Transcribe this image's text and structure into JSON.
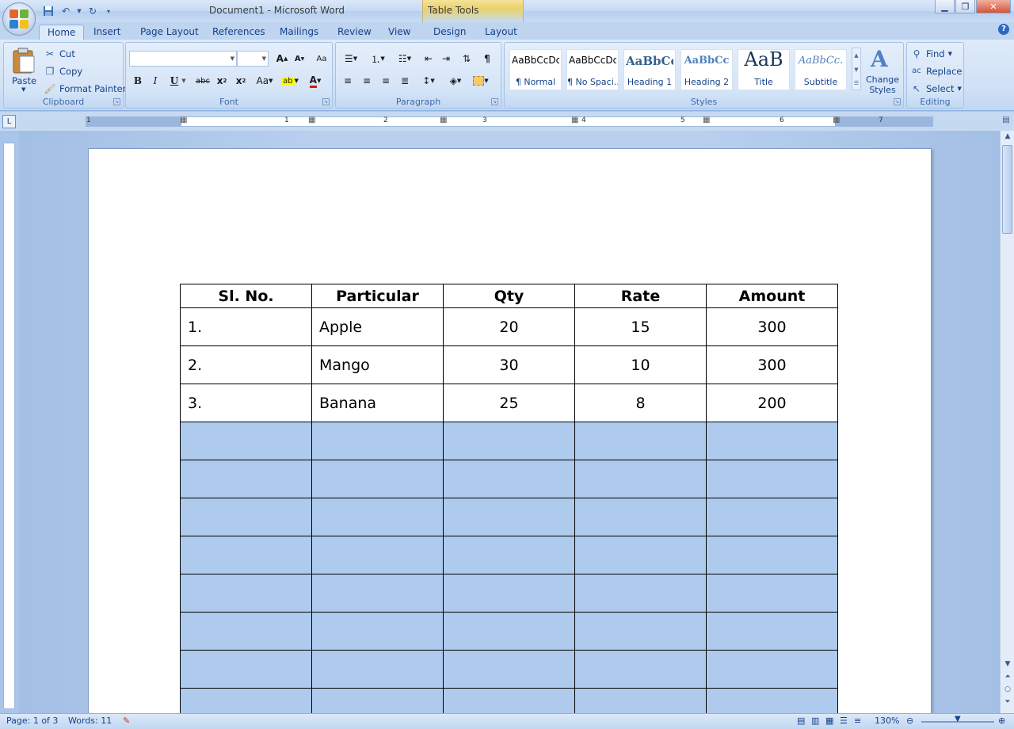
{
  "window": {
    "title": "Document1 - Microsoft Word",
    "contextual_tab_group": "Table Tools"
  },
  "tabs": [
    "Home",
    "Insert",
    "Page Layout",
    "References",
    "Mailings",
    "Review",
    "View",
    "Design",
    "Layout"
  ],
  "active_tab": "Home",
  "ribbon": {
    "clipboard": {
      "label": "Clipboard",
      "paste": "Paste",
      "cut": "Cut",
      "copy": "Copy",
      "format_painter": "Format Painter"
    },
    "font": {
      "label": "Font",
      "font_name": "",
      "font_size": ""
    },
    "paragraph": {
      "label": "Paragraph"
    },
    "styles": {
      "label": "Styles",
      "items": [
        {
          "sample": "AaBbCcDc",
          "name": "¶ Normal"
        },
        {
          "sample": "AaBbCcDc",
          "name": "¶ No Spaci..."
        },
        {
          "sample": "AaBbCc",
          "name": "Heading 1"
        },
        {
          "sample": "AaBbCc",
          "name": "Heading 2"
        },
        {
          "sample": "AaB",
          "name": "Title"
        },
        {
          "sample": "AaBbCc.",
          "name": "Subtitle"
        }
      ],
      "change_styles_1": "Change",
      "change_styles_2": "Styles"
    },
    "editing": {
      "label": "Editing",
      "find": "Find",
      "replace": "Replace",
      "select": "Select"
    }
  },
  "ruler_numbers": [
    "1",
    "1",
    "2",
    "3",
    "4",
    "5",
    "6",
    "7"
  ],
  "table": {
    "headers": [
      "Sl. No.",
      "Particular",
      "Qty",
      "Rate",
      "Amount"
    ],
    "rows": [
      [
        "1.",
        "Apple",
        "20",
        "15",
        "300"
      ],
      [
        "2.",
        "Mango",
        "30",
        "10",
        "300"
      ],
      [
        "3.",
        "Banana",
        "25",
        "8",
        "200"
      ]
    ],
    "selected_empty_rows": 8
  },
  "status": {
    "page": "Page: 1 of 3",
    "words": "Words: 11",
    "zoom": "130%"
  },
  "colors": {
    "ribbon_bg": "#d0e1f6",
    "selection": "#aecbee",
    "doc_bg": "#b8cfee"
  }
}
